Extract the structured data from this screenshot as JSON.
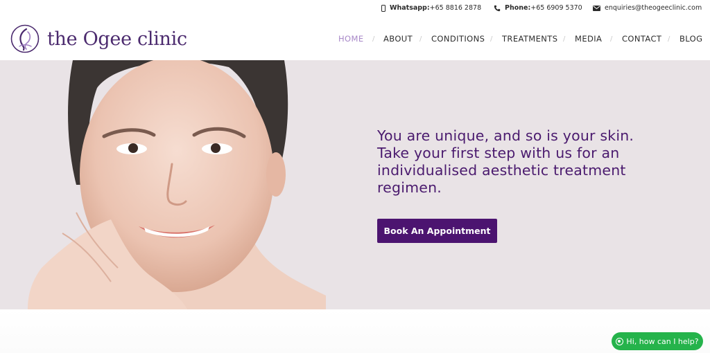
{
  "topbar": {
    "whatsapp_label": "Whatsapp:",
    "whatsapp_number": "+65 8816 2878",
    "phone_label": "Phone:",
    "phone_number": "+65 6909 5370",
    "email": "enquiries@theogeeclinic.com"
  },
  "brand": {
    "name": "the Ogee clinic",
    "color": "#4b2a6e"
  },
  "nav": {
    "items": [
      {
        "label": "HOME",
        "active": true
      },
      {
        "label": "ABOUT"
      },
      {
        "label": "CONDITIONS"
      },
      {
        "label": "TREATMENTS"
      },
      {
        "label": "MEDIA"
      },
      {
        "label": "CONTACT"
      },
      {
        "label": "BLOG"
      }
    ],
    "separator": "/",
    "active_color": "#a888c8"
  },
  "hero": {
    "headline": "You are unique, and so is your skin. Take your first step with us for an individualised aesthetic treatment regimen.",
    "cta_label": "Book An Appointment",
    "background": "#e9e3e6",
    "accent": "#4c1470"
  },
  "chat": {
    "label": "Hi, how can I help?",
    "color": "#25b34b"
  }
}
